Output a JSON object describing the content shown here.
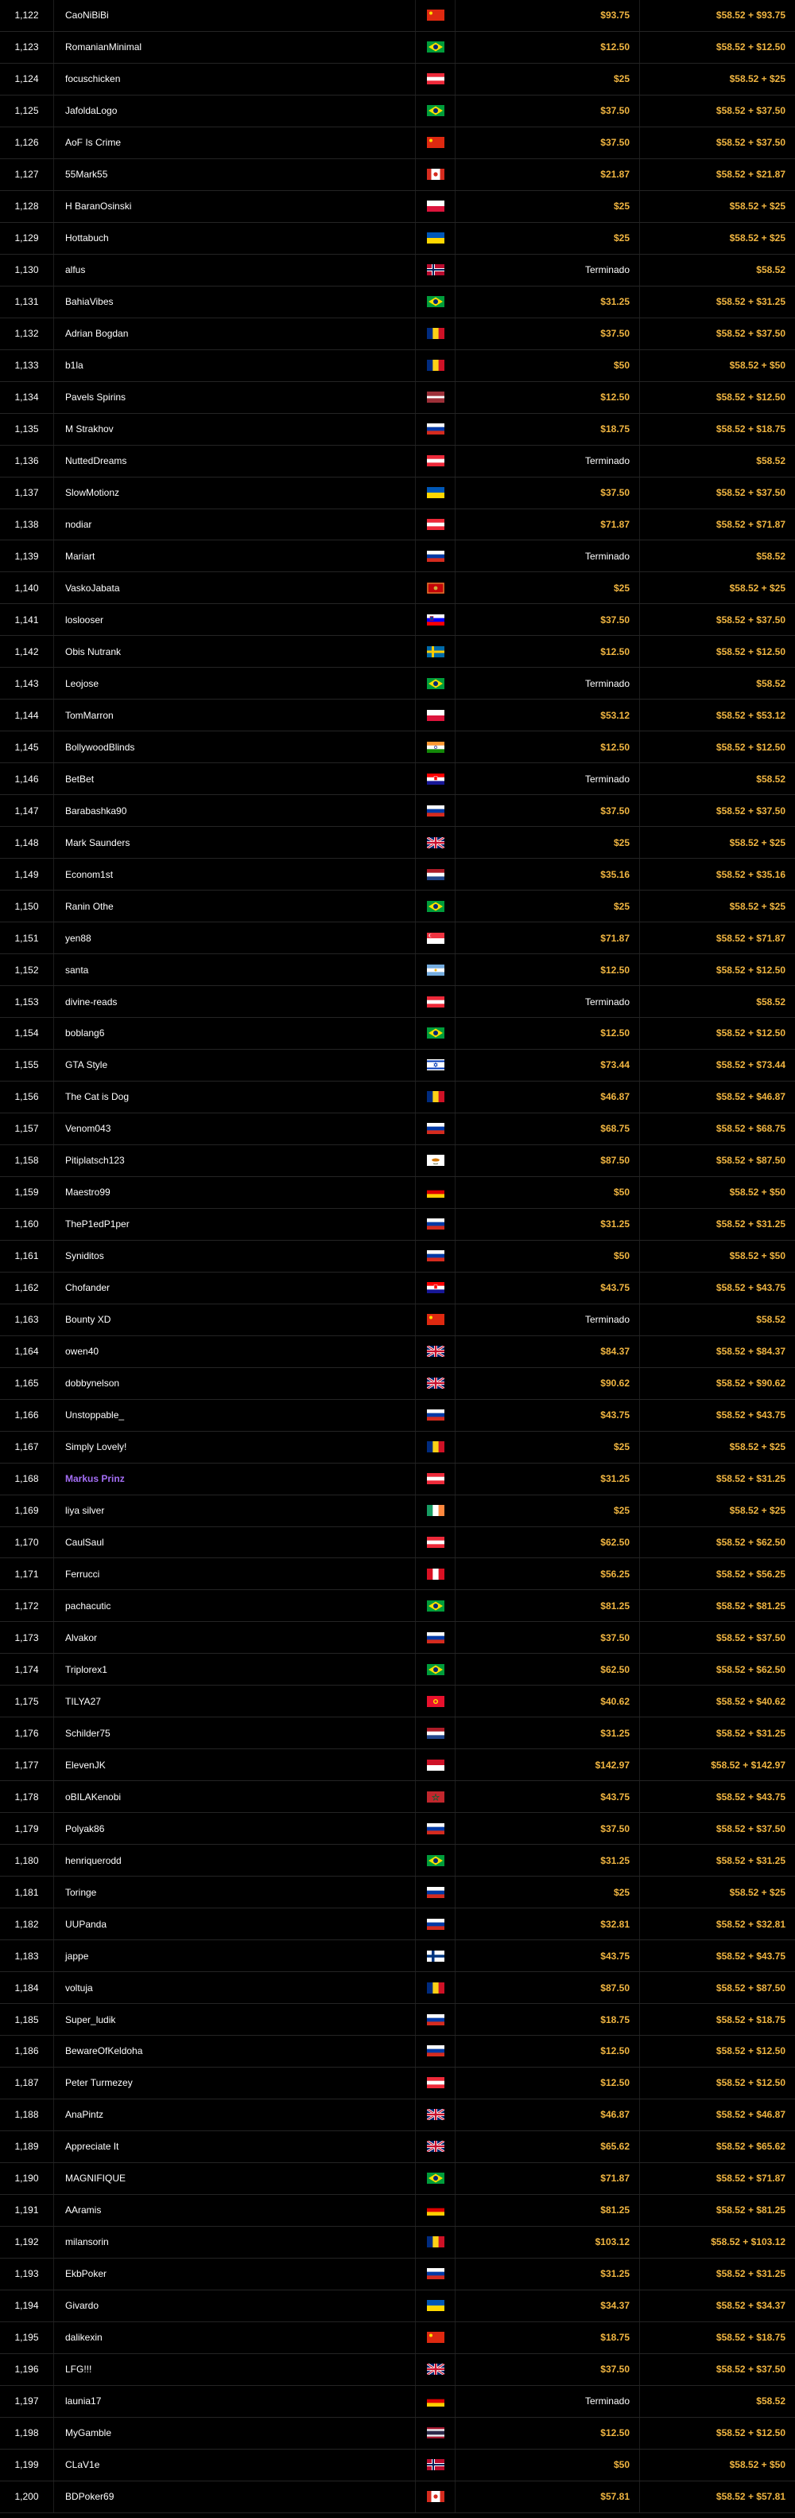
{
  "colors": {
    "background": "#000000",
    "text": "#ffffff",
    "gold": "#f0b541",
    "highlight": "#a46ef5",
    "divider": "#242424"
  },
  "rows": [
    {
      "rank": "1,122",
      "player": "CaoNiBiBi",
      "flag_icon": "china-flag-icon",
      "prize": "$93.75",
      "total": "$58.52 + $93.75"
    },
    {
      "rank": "1,123",
      "player": "RomanianMinimal",
      "flag_icon": "brazil-flag-icon",
      "prize": "$12.50",
      "total": "$58.52 + $12.50"
    },
    {
      "rank": "1,124",
      "player": "focuschicken",
      "flag_icon": "austria-flag-icon",
      "prize": "$25",
      "total": "$58.52 + $25"
    },
    {
      "rank": "1,125",
      "player": "JafoldaLogo",
      "flag_icon": "brazil-flag-icon",
      "prize": "$37.50",
      "total": "$58.52 + $37.50"
    },
    {
      "rank": "1,126",
      "player": "AoF Is Crime",
      "flag_icon": "china-flag-icon",
      "prize": "$37.50",
      "total": "$58.52 + $37.50"
    },
    {
      "rank": "1,127",
      "player": "55Mark55",
      "flag_icon": "canada-flag-icon",
      "prize": "$21.87",
      "total": "$58.52 + $21.87"
    },
    {
      "rank": "1,128",
      "player": "H BaranOsinski",
      "flag_icon": "poland-flag-icon",
      "prize": "$25",
      "total": "$58.52 + $25"
    },
    {
      "rank": "1,129",
      "player": "Hottabuch",
      "flag_icon": "ukraine-flag-icon",
      "prize": "$25",
      "total": "$58.52 + $25"
    },
    {
      "rank": "1,130",
      "player": "alfus",
      "flag_icon": "norway-flag-icon",
      "prize": "Terminado",
      "total": "$58.52"
    },
    {
      "rank": "1,131",
      "player": "BahiaVibes",
      "flag_icon": "brazil-flag-icon",
      "prize": "$31.25",
      "total": "$58.52 + $31.25"
    },
    {
      "rank": "1,132",
      "player": "Adrian Bogdan",
      "flag_icon": "romania-flag-icon",
      "prize": "$37.50",
      "total": "$58.52 + $37.50"
    },
    {
      "rank": "1,133",
      "player": "b1la",
      "flag_icon": "romania-flag-icon",
      "prize": "$50",
      "total": "$58.52 + $50"
    },
    {
      "rank": "1,134",
      "player": "Pavels Spirins",
      "flag_icon": "latvia-flag-icon",
      "prize": "$12.50",
      "total": "$58.52 + $12.50"
    },
    {
      "rank": "1,135",
      "player": "M Strakhov",
      "flag_icon": "russia-flag-icon",
      "prize": "$18.75",
      "total": "$58.52 + $18.75"
    },
    {
      "rank": "1,136",
      "player": "NuttedDreams",
      "flag_icon": "austria-flag-icon",
      "prize": "Terminado",
      "total": "$58.52"
    },
    {
      "rank": "1,137",
      "player": "SlowMotionz",
      "flag_icon": "ukraine-flag-icon",
      "prize": "$37.50",
      "total": "$58.52 + $37.50"
    },
    {
      "rank": "1,138",
      "player": "nodiar",
      "flag_icon": "austria-flag-icon",
      "prize": "$71.87",
      "total": "$58.52 + $71.87"
    },
    {
      "rank": "1,139",
      "player": "Mariart",
      "flag_icon": "russia-flag-icon",
      "prize": "Terminado",
      "total": "$58.52"
    },
    {
      "rank": "1,140",
      "player": "VaskoJabata",
      "flag_icon": "montenegro-flag-icon",
      "prize": "$25",
      "total": "$58.52 + $25"
    },
    {
      "rank": "1,141",
      "player": "loslooser",
      "flag_icon": "slovenia-flag-icon",
      "prize": "$37.50",
      "total": "$58.52 + $37.50"
    },
    {
      "rank": "1,142",
      "player": "Obis Nutrank",
      "flag_icon": "sweden-flag-icon",
      "prize": "$12.50",
      "total": "$58.52 + $12.50"
    },
    {
      "rank": "1,143",
      "player": "Leojose",
      "flag_icon": "brazil-flag-icon",
      "prize": "Terminado",
      "total": "$58.52"
    },
    {
      "rank": "1,144",
      "player": "TomMarron",
      "flag_icon": "poland-flag-icon",
      "prize": "$53.12",
      "total": "$58.52 + $53.12"
    },
    {
      "rank": "1,145",
      "player": "BollywoodBlinds",
      "flag_icon": "india-flag-icon",
      "prize": "$12.50",
      "total": "$58.52 + $12.50"
    },
    {
      "rank": "1,146",
      "player": "BetBet",
      "flag_icon": "croatia-flag-icon",
      "prize": "Terminado",
      "total": "$58.52"
    },
    {
      "rank": "1,147",
      "player": "Barabashka90",
      "flag_icon": "russia-flag-icon",
      "prize": "$37.50",
      "total": "$58.52 + $37.50"
    },
    {
      "rank": "1,148",
      "player": "Mark Saunders",
      "flag_icon": "uk-flag-icon",
      "prize": "$25",
      "total": "$58.52 + $25"
    },
    {
      "rank": "1,149",
      "player": "Econom1st",
      "flag_icon": "netherlands-flag-icon",
      "prize": "$35.16",
      "total": "$58.52 + $35.16"
    },
    {
      "rank": "1,150",
      "player": "Ranin Othe",
      "flag_icon": "brazil-flag-icon",
      "prize": "$25",
      "total": "$58.52 + $25"
    },
    {
      "rank": "1,151",
      "player": "yen88",
      "flag_icon": "singapore-flag-icon",
      "prize": "$71.87",
      "total": "$58.52 + $71.87"
    },
    {
      "rank": "1,152",
      "player": "santa",
      "flag_icon": "argentina-flag-icon",
      "prize": "$12.50",
      "total": "$58.52 + $12.50"
    },
    {
      "rank": "1,153",
      "player": "divine-reads",
      "flag_icon": "austria-flag-icon",
      "prize": "Terminado",
      "total": "$58.52"
    },
    {
      "rank": "1,154",
      "player": "boblang6",
      "flag_icon": "brazil-flag-icon",
      "prize": "$12.50",
      "total": "$58.52 + $12.50"
    },
    {
      "rank": "1,155",
      "player": "GTA Style",
      "flag_icon": "israel-flag-icon",
      "prize": "$73.44",
      "total": "$58.52 + $73.44"
    },
    {
      "rank": "1,156",
      "player": "The Cat is Dog",
      "flag_icon": "romania-flag-icon",
      "prize": "$46.87",
      "total": "$58.52 + $46.87"
    },
    {
      "rank": "1,157",
      "player": "Venom043",
      "flag_icon": "russia-flag-icon",
      "prize": "$68.75",
      "total": "$58.52 + $68.75"
    },
    {
      "rank": "1,158",
      "player": "Pitiplatsch123",
      "flag_icon": "cyprus-flag-icon",
      "prize": "$87.50",
      "total": "$58.52 + $87.50"
    },
    {
      "rank": "1,159",
      "player": "Maestro99",
      "flag_icon": "germany-flag-icon",
      "prize": "$50",
      "total": "$58.52 + $50"
    },
    {
      "rank": "1,160",
      "player": "TheP1edP1per",
      "flag_icon": "russia-flag-icon",
      "prize": "$31.25",
      "total": "$58.52 + $31.25"
    },
    {
      "rank": "1,161",
      "player": "Syniditos",
      "flag_icon": "russia-flag-icon",
      "prize": "$50",
      "total": "$58.52 + $50"
    },
    {
      "rank": "1,162",
      "player": "Chofander",
      "flag_icon": "croatia-flag-icon",
      "prize": "$43.75",
      "total": "$58.52 + $43.75"
    },
    {
      "rank": "1,163",
      "player": "Bounty XD",
      "flag_icon": "china-flag-icon",
      "prize": "Terminado",
      "total": "$58.52"
    },
    {
      "rank": "1,164",
      "player": "owen40",
      "flag_icon": "uk-flag-icon",
      "prize": "$84.37",
      "total": "$58.52 + $84.37"
    },
    {
      "rank": "1,165",
      "player": "dobbynelson",
      "flag_icon": "uk-flag-icon",
      "prize": "$90.62",
      "total": "$58.52 + $90.62"
    },
    {
      "rank": "1,166",
      "player": "Unstoppable_",
      "flag_icon": "russia-flag-icon",
      "prize": "$43.75",
      "total": "$58.52 + $43.75"
    },
    {
      "rank": "1,167",
      "player": "Simply Lovely!",
      "flag_icon": "romania-flag-icon",
      "prize": "$25",
      "total": "$58.52 + $25"
    },
    {
      "rank": "1,168",
      "player": "Markus Prinz",
      "flag_icon": "austria-flag-icon",
      "prize": "$31.25",
      "total": "$58.52 + $31.25",
      "highlight": true
    },
    {
      "rank": "1,169",
      "player": "liya silver",
      "flag_icon": "ireland-flag-icon",
      "prize": "$25",
      "total": "$58.52 + $25"
    },
    {
      "rank": "1,170",
      "player": "CaulSaul",
      "flag_icon": "austria-flag-icon",
      "prize": "$62.50",
      "total": "$58.52 + $62.50"
    },
    {
      "rank": "1,171",
      "player": "Ferrucci",
      "flag_icon": "peru-flag-icon",
      "prize": "$56.25",
      "total": "$58.52 + $56.25"
    },
    {
      "rank": "1,172",
      "player": "pachacutic",
      "flag_icon": "brazil-flag-icon",
      "prize": "$81.25",
      "total": "$58.52 + $81.25"
    },
    {
      "rank": "1,173",
      "player": "Alvakor",
      "flag_icon": "russia-flag-icon",
      "prize": "$37.50",
      "total": "$58.52 + $37.50"
    },
    {
      "rank": "1,174",
      "player": "Triplorex1",
      "flag_icon": "brazil-flag-icon",
      "prize": "$62.50",
      "total": "$58.52 + $62.50"
    },
    {
      "rank": "1,175",
      "player": "TILYA27",
      "flag_icon": "kyrgyzstan-flag-icon",
      "prize": "$40.62",
      "total": "$58.52 + $40.62"
    },
    {
      "rank": "1,176",
      "player": "Schilder75",
      "flag_icon": "netherlands-flag-icon",
      "prize": "$31.25",
      "total": "$58.52 + $31.25"
    },
    {
      "rank": "1,177",
      "player": "ElevenJK",
      "flag_icon": "indonesia-flag-icon",
      "prize": "$142.97",
      "total": "$58.52 + $142.97"
    },
    {
      "rank": "1,178",
      "player": "oBILAKenobi",
      "flag_icon": "morocco-flag-icon",
      "prize": "$43.75",
      "total": "$58.52 + $43.75"
    },
    {
      "rank": "1,179",
      "player": "Polyak86",
      "flag_icon": "russia-flag-icon",
      "prize": "$37.50",
      "total": "$58.52 + $37.50"
    },
    {
      "rank": "1,180",
      "player": "henriquerodd",
      "flag_icon": "brazil-flag-icon",
      "prize": "$31.25",
      "total": "$58.52 + $31.25"
    },
    {
      "rank": "1,181",
      "player": "Toringe",
      "flag_icon": "russia-flag-icon",
      "prize": "$25",
      "total": "$58.52 + $25"
    },
    {
      "rank": "1,182",
      "player": "UUPanda",
      "flag_icon": "russia-flag-icon",
      "prize": "$32.81",
      "total": "$58.52 + $32.81"
    },
    {
      "rank": "1,183",
      "player": "jappe",
      "flag_icon": "finland-flag-icon",
      "prize": "$43.75",
      "total": "$58.52 + $43.75"
    },
    {
      "rank": "1,184",
      "player": "voltuja",
      "flag_icon": "romania-flag-icon",
      "prize": "$87.50",
      "total": "$58.52 + $87.50"
    },
    {
      "rank": "1,185",
      "player": "Super_ludik",
      "flag_icon": "russia-flag-icon",
      "prize": "$18.75",
      "total": "$58.52 + $18.75"
    },
    {
      "rank": "1,186",
      "player": "BewareOfKeldoha",
      "flag_icon": "russia-flag-icon",
      "prize": "$12.50",
      "total": "$58.52 + $12.50"
    },
    {
      "rank": "1,187",
      "player": "Peter Turmezey",
      "flag_icon": "austria-flag-icon",
      "prize": "$12.50",
      "total": "$58.52 + $12.50"
    },
    {
      "rank": "1,188",
      "player": "AnaPintz",
      "flag_icon": "uk-flag-icon",
      "prize": "$46.87",
      "total": "$58.52 + $46.87"
    },
    {
      "rank": "1,189",
      "player": "Appreciate It",
      "flag_icon": "uk-flag-icon",
      "prize": "$65.62",
      "total": "$58.52 + $65.62"
    },
    {
      "rank": "1,190",
      "player": "MAGNIFIQUE",
      "flag_icon": "brazil-flag-icon",
      "prize": "$71.87",
      "total": "$58.52 + $71.87"
    },
    {
      "rank": "1,191",
      "player": "AAramis",
      "flag_icon": "germany-flag-icon",
      "prize": "$81.25",
      "total": "$58.52 + $81.25"
    },
    {
      "rank": "1,192",
      "player": "milansorin",
      "flag_icon": "romania-flag-icon",
      "prize": "$103.12",
      "total": "$58.52 + $103.12"
    },
    {
      "rank": "1,193",
      "player": "EkbPoker",
      "flag_icon": "russia-flag-icon",
      "prize": "$31.25",
      "total": "$58.52 + $31.25"
    },
    {
      "rank": "1,194",
      "player": "Givardo",
      "flag_icon": "ukraine-flag-icon",
      "prize": "$34.37",
      "total": "$58.52 + $34.37"
    },
    {
      "rank": "1,195",
      "player": "dalikexin",
      "flag_icon": "china-flag-icon",
      "prize": "$18.75",
      "total": "$58.52 + $18.75"
    },
    {
      "rank": "1,196",
      "player": "LFG!!!",
      "flag_icon": "uk-flag-icon",
      "prize": "$37.50",
      "total": "$58.52 + $37.50"
    },
    {
      "rank": "1,197",
      "player": "launia17",
      "flag_icon": "germany-flag-icon",
      "prize": "Terminado",
      "total": "$58.52"
    },
    {
      "rank": "1,198",
      "player": "MyGamble",
      "flag_icon": "thailand-flag-icon",
      "prize": "$12.50",
      "total": "$58.52 + $12.50"
    },
    {
      "rank": "1,199",
      "player": "CLaV1e",
      "flag_icon": "norway-flag-icon",
      "prize": "$50",
      "total": "$58.52 + $50"
    },
    {
      "rank": "1,200",
      "player": "BDPoker69",
      "flag_icon": "canada-flag-icon",
      "prize": "$57.81",
      "total": "$58.52 + $57.81"
    }
  ]
}
